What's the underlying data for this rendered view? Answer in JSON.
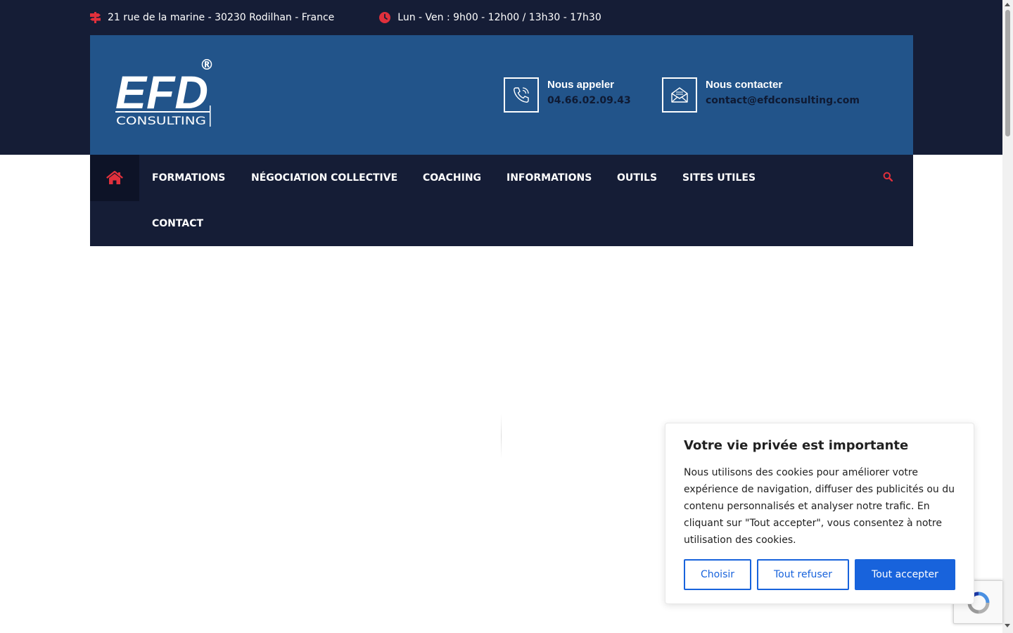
{
  "topbar": {
    "address": "21 rue de la marine - 30230 Rodilhan - France",
    "hours": "Lun - Ven : 9h00 - 12h00 / 13h30 - 17h30"
  },
  "header": {
    "logo": {
      "main": "EFD",
      "sub": "CONSULTING",
      "mark": "®"
    },
    "call": {
      "title": "Nous appeler",
      "value": "04.66.02.09.43"
    },
    "contact": {
      "title": "Nous contacter",
      "value": "contact@efdconsulting.com"
    }
  },
  "nav": {
    "items": [
      {
        "label": "FORMATIONS"
      },
      {
        "label": "NÉGOCIATION COLLECTIVE"
      },
      {
        "label": "COACHING"
      },
      {
        "label": "INFORMATIONS"
      },
      {
        "label": "OUTILS"
      },
      {
        "label": "SITES UTILES"
      },
      {
        "label": "CONTACT"
      }
    ]
  },
  "cookie": {
    "title": "Votre vie privée est importante",
    "text": "Nous utilisons des cookies pour améliorer votre expérience de navigation, diffuser des publicités ou du contenu personnalisés et analyser notre trafic. En cliquant sur \"Tout accepter\", vous consentez à notre utilisation des cookies.",
    "buttons": {
      "choose": "Choisir",
      "reject": "Tout refuser",
      "accept": "Tout accepter"
    }
  },
  "colors": {
    "dark_navy": "#151d36",
    "header_blue": "#22548a",
    "accent_red": "#e0303c",
    "button_blue": "#1863dc"
  },
  "icons": {
    "address": "signpost-icon",
    "hours": "clock-icon",
    "call": "phone-icon",
    "contact": "envelope-icon",
    "home": "home-icon",
    "search": "search-icon"
  }
}
